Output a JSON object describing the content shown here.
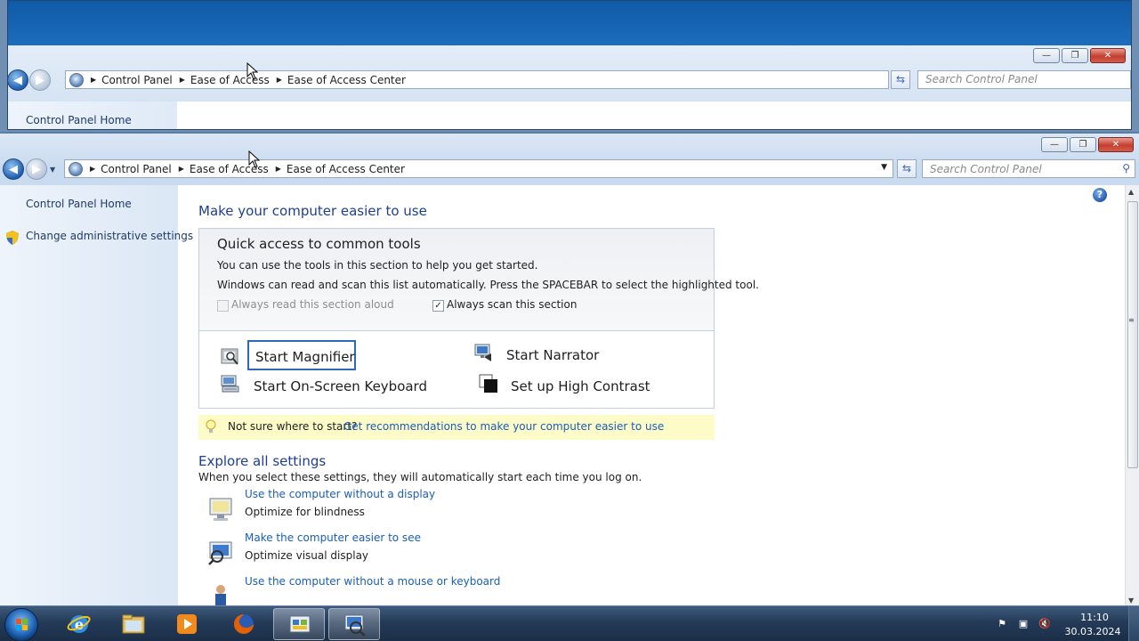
{
  "background_window": {
    "breadcrumb": [
      "Control Panel",
      "Ease of Access",
      "Ease of Access Center"
    ],
    "search_placeholder": "Search Control Panel",
    "left_link": "Control Panel Home"
  },
  "window": {
    "breadcrumb": {
      "item_0": "Control Panel",
      "item_1": "Ease of Access",
      "item_2": "Ease of Access Center"
    },
    "search_placeholder": "Search Control Panel",
    "caption_buttons": {
      "minimize": "—",
      "restore": "❐",
      "close": "✕"
    }
  },
  "sidebar": {
    "home_link": "Control Panel Home",
    "admin_link": "Change administrative settings"
  },
  "main": {
    "title": "Make your computer easier to use",
    "quick_access": {
      "title": "Quick access to common tools",
      "line1": "You can use the tools in this section to help you get started.",
      "line2": "Windows can read and scan this list automatically.  Press the SPACEBAR to select the highlighted tool.",
      "read_aloud_label": "Always read this section aloud",
      "read_aloud_checked": false,
      "scan_label": "Always scan this section",
      "scan_checked": true,
      "tools": {
        "magnifier": "Start Magnifier",
        "narrator": "Start Narrator",
        "osk": "Start On-Screen Keyboard",
        "high_contrast": "Set up High Contrast"
      }
    },
    "tip": {
      "text": "Not sure where to start?",
      "link": "Get recommendations to make your computer easier to use"
    },
    "explore": {
      "title": "Explore all settings",
      "subtitle": "When you select these settings, they will automatically start each time you log on.",
      "items": [
        {
          "link": "Use the computer without a display",
          "desc": "Optimize for blindness"
        },
        {
          "link": "Make the computer easier to see",
          "desc": "Optimize visual display"
        },
        {
          "link": "Use the computer without a mouse or keyboard",
          "desc": ""
        }
      ]
    }
  },
  "taskbar": {
    "apps": [
      "start",
      "internet-explorer",
      "windows-explorer",
      "media-player",
      "firefox",
      "control-panel",
      "magnifier"
    ],
    "active_apps": [
      "control-panel",
      "magnifier"
    ],
    "time": "11:10",
    "date": "30.03.2024"
  },
  "colors": {
    "link": "#1a5eb5",
    "heading": "#1e3f8f",
    "tip_background": "#fdfbc8",
    "focus_border": "#2c6ab9"
  }
}
